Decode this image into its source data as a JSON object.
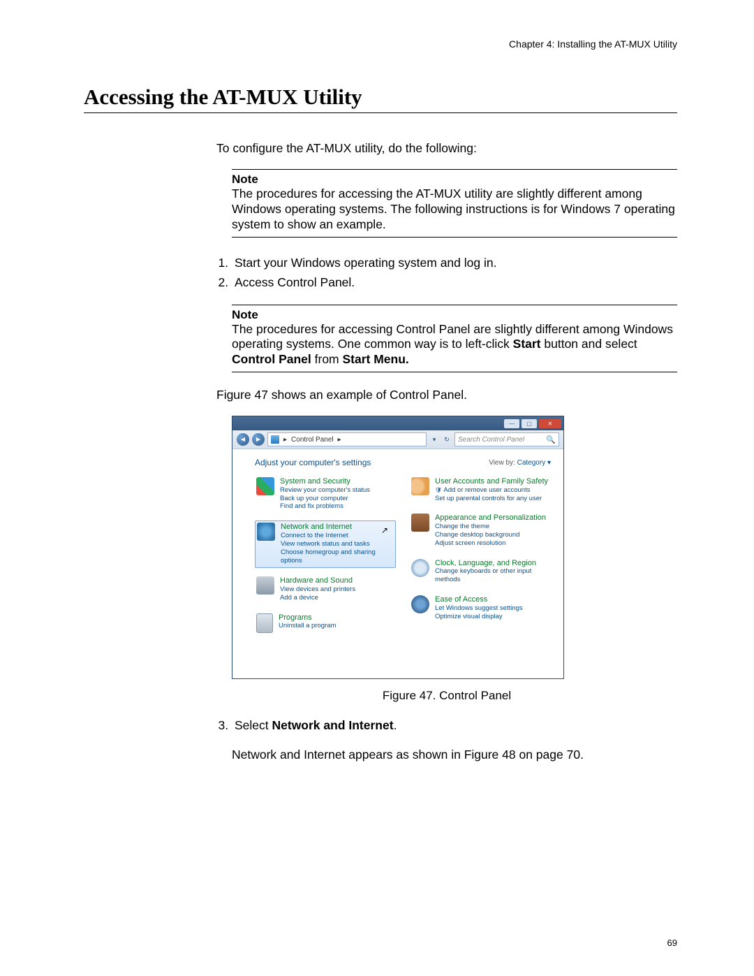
{
  "chapter_header": "Chapter 4: Installing the AT-MUX Utility",
  "section_title": "Accessing the AT-MUX Utility",
  "intro": "To configure the AT-MUX utility, do the following:",
  "note1": {
    "label": "Note",
    "text": "The procedures for accessing the AT-MUX utility are slightly different among Windows operating systems. The following instructions is for Windows 7 operating system to show an example."
  },
  "step1": "Start your Windows operating system and log in.",
  "step2": "Access Control Panel.",
  "note2": {
    "label": "Note",
    "text_pre": "The procedures for accessing Control Panel are slightly different among Windows operating systems. One common way is to left-click ",
    "b1": "Start",
    "mid1": " button and select ",
    "b2": "Control Panel",
    "mid2": " from ",
    "b3": "Start Menu."
  },
  "fig_intro": "Figure 47 shows an example of Control Panel.",
  "fig_caption": "Figure 47. Control Panel",
  "step3_pre": "Select ",
  "step3_b": "Network and Internet",
  "step3_post": ".",
  "after_step3": "Network and Internet appears as shown in Figure 48 on page 70.",
  "page_number": "69",
  "cp": {
    "breadcrumb_sep": "▸",
    "breadcrumb": "Control Panel",
    "search_placeholder": "Search Control Panel",
    "adjust": "Adjust your computer's settings",
    "view_by_label": "View by:",
    "view_by_value": "Category ▾",
    "left": [
      {
        "title": "System and Security",
        "subs": [
          "Review your computer's status",
          "Back up your computer",
          "Find and fix problems"
        ],
        "icon": "ic-sys"
      },
      {
        "title": "Network and Internet",
        "subs": [
          "Connect to the Internet",
          "View network status and tasks",
          "Choose homegroup and sharing options"
        ],
        "icon": "ic-net",
        "selected": true
      },
      {
        "title": "Hardware and Sound",
        "subs": [
          "View devices and printers",
          "Add a device"
        ],
        "icon": "ic-hw"
      },
      {
        "title": "Programs",
        "subs": [
          "Uninstall a program"
        ],
        "icon": "ic-prg"
      }
    ],
    "right": [
      {
        "title": "User Accounts and Family Safety",
        "subs": [
          "Add or remove user accounts",
          "Set up parental controls for any user"
        ],
        "icon": "ic-usr",
        "shield": true
      },
      {
        "title": "Appearance and Personalization",
        "subs": [
          "Change the theme",
          "Change desktop background",
          "Adjust screen resolution"
        ],
        "icon": "ic-app"
      },
      {
        "title": "Clock, Language, and Region",
        "subs": [
          "Change keyboards or other input methods"
        ],
        "icon": "ic-clk"
      },
      {
        "title": "Ease of Access",
        "subs": [
          "Let Windows suggest settings",
          "Optimize visual display"
        ],
        "icon": "ic-eoa"
      }
    ]
  }
}
